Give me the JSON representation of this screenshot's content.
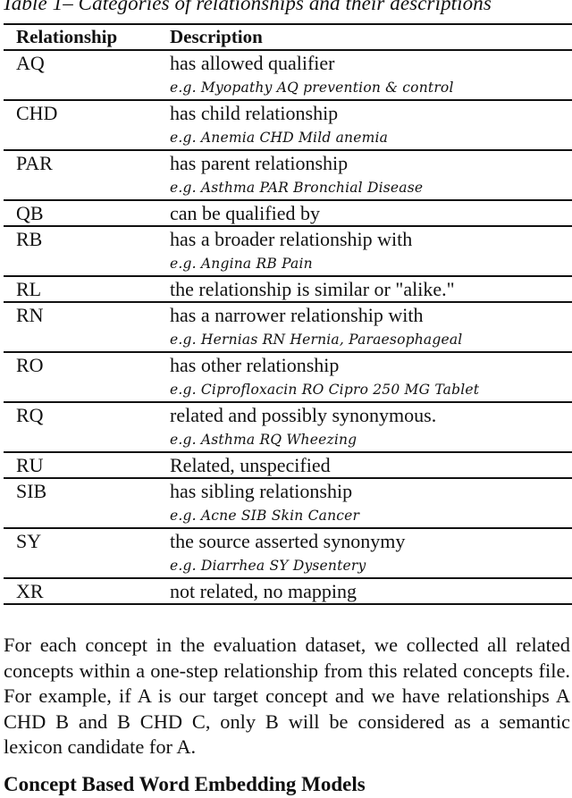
{
  "caption": "Table 1– Categories of relationships and their descriptions",
  "table": {
    "headers": {
      "relationship": "Relationship",
      "description": "Description"
    },
    "rows": [
      {
        "code": "AQ",
        "description": "has allowed qualifier",
        "example": "e.g. Myopathy AQ prevention & control"
      },
      {
        "code": "CHD",
        "description": "has child relationship",
        "example": "e.g. Anemia CHD Mild anemia"
      },
      {
        "code": "PAR",
        "description": "has parent relationship",
        "example": "e.g. Asthma PAR Bronchial Disease"
      },
      {
        "code": "QB",
        "description": "can be qualified by",
        "example": null
      },
      {
        "code": "RB",
        "description": "has a broader relationship with",
        "example": "e.g. Angina RB Pain"
      },
      {
        "code": "RL",
        "description": "the relationship is similar or \"alike.\"",
        "example": null
      },
      {
        "code": "RN",
        "description": "has a narrower relationship with",
        "example": "e.g. Hernias RN Hernia, Paraesophageal"
      },
      {
        "code": "RO",
        "description": "has other relationship",
        "example": "e.g. Ciprofloxacin RO Cipro 250 MG Tablet"
      },
      {
        "code": "RQ",
        "description": "related and possibly synonymous.",
        "example": "e.g. Asthma  RQ Wheezing"
      },
      {
        "code": "RU",
        "description": "Related, unspecified",
        "example": null
      },
      {
        "code": "SIB",
        "description": "has sibling relationship",
        "example": "e.g. Acne SIB Skin Cancer"
      },
      {
        "code": "SY",
        "description": "the source asserted synonymy",
        "example": "e.g. Diarrhea SY Dysentery"
      },
      {
        "code": "XR",
        "description": "not related, no mapping",
        "example": null
      }
    ]
  },
  "paragraph": "For each concept in the evaluation dataset, we collected all related concepts within a one-step relationship from this related concepts file. For example, if A is our target concept and we have relationships A CHD B and B CHD C, only B will be considered as a semantic lexicon candidate for A.",
  "section_heading": "Concept Based Word Embedding Models"
}
